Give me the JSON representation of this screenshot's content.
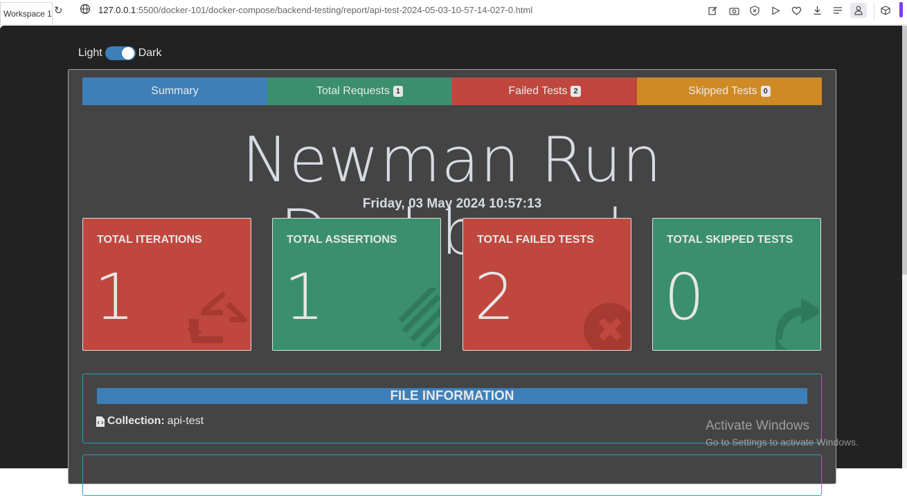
{
  "browser": {
    "workspace_tab": "Workspace 1",
    "url_host": "127.0.0.1",
    "url_path": ":5500/docker-101/docker-compose/backend-testing/report/api-test-2024-05-03-10-57-14-027-0.html"
  },
  "theme": {
    "light_label": "Light",
    "dark_label": "Dark"
  },
  "tabs": [
    {
      "label": "Summary"
    },
    {
      "label": "Total Requests",
      "badge": "1"
    },
    {
      "label": "Failed Tests",
      "badge": "2"
    },
    {
      "label": "Skipped Tests",
      "badge": "0"
    }
  ],
  "dashboard": {
    "title": "Newman Run Dashboard",
    "date": "Friday, 03 May 2024 10:57:13"
  },
  "cards": [
    {
      "label": "TOTAL ITERATIONS",
      "value": "1",
      "icon": "retweet-icon",
      "color": "#c0473d"
    },
    {
      "label": "TOTAL ASSERTIONS",
      "value": "1",
      "icon": "assertions-icon",
      "color": "#3a8f6e"
    },
    {
      "label": "TOTAL FAILED TESTS",
      "value": "2",
      "icon": "times-circle-icon",
      "color": "#c0473d"
    },
    {
      "label": "TOTAL SKIPPED TESTS",
      "value": "0",
      "icon": "share-arrow-icon",
      "color": "#3a8f6e"
    }
  ],
  "file_info": {
    "title": "FILE INFORMATION",
    "collection_label": "Collection:",
    "collection_value": "api-test"
  },
  "watermark": {
    "line1": "Activate Windows",
    "line2": "Go to Settings to activate Windows."
  }
}
